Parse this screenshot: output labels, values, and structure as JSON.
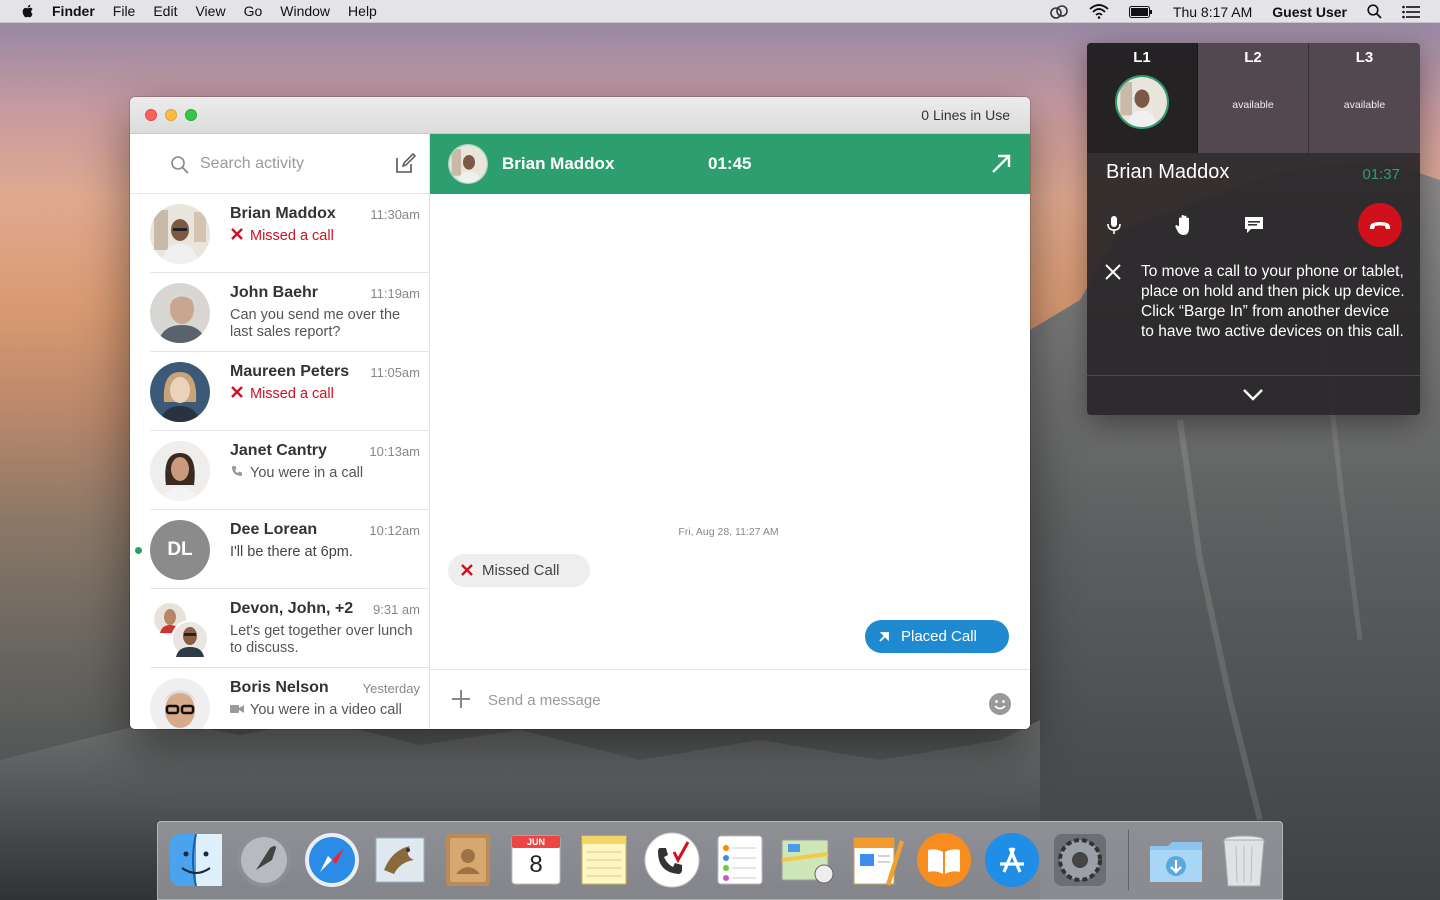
{
  "menubar": {
    "app_name": "Finder",
    "menus": [
      "File",
      "Edit",
      "View",
      "Go",
      "Window",
      "Help"
    ],
    "clock": "Thu 8:17 AM",
    "user": "Guest User"
  },
  "window": {
    "lines_in_use": "0 Lines in Use"
  },
  "sidebar": {
    "search_placeholder": "Search activity",
    "conversations": [
      {
        "name": "Brian Maddox",
        "time": "11:30am",
        "preview": "Missed a call",
        "kind": "missed"
      },
      {
        "name": "John Baehr",
        "time": "11:19am",
        "preview": "Can you send me over the last sales report?",
        "kind": "text"
      },
      {
        "name": "Maureen Peters",
        "time": "11:05am",
        "preview": "Missed a call",
        "kind": "missed"
      },
      {
        "name": "Janet Cantry",
        "time": "10:13am",
        "preview": "You were in a call",
        "kind": "call"
      },
      {
        "name": "Dee Lorean",
        "time": "10:12am",
        "preview": "I'll be there at 6pm.",
        "kind": "text",
        "initials": "DL"
      },
      {
        "name": "Devon, John, +2",
        "time": "9:31 am",
        "preview": "Let's get together over lunch to discuss.",
        "kind": "text"
      },
      {
        "name": "Boris Nelson",
        "time": "Yesterday",
        "preview": "You were in a video call",
        "kind": "video"
      }
    ]
  },
  "chat": {
    "header_name": "Brian Maddox",
    "header_time": "01:45",
    "date_stamp": "Fri, Aug 28, 11:27 AM",
    "missed_label": "Missed Call",
    "placed_label": "Placed Call",
    "message_placeholder": "Send a message"
  },
  "call_panel": {
    "lines": [
      {
        "label": "L1",
        "status": ""
      },
      {
        "label": "L2",
        "status": "available"
      },
      {
        "label": "L3",
        "status": "available"
      }
    ],
    "caller_name": "Brian Maddox",
    "call_time": "01:37",
    "tip": "To move a call to your phone or tablet, place on hold and then pick up device. Click “Barge In” from another device to have two active devices on this call."
  },
  "dock": {
    "items": [
      "finder-icon",
      "launchpad-icon",
      "safari-icon",
      "mail-icon",
      "contacts-icon",
      "calendar-icon",
      "notes-icon",
      "phone-app-icon",
      "reminders-icon",
      "maps-icon",
      "pages-icon",
      "ibooks-icon",
      "app-store-icon",
      "system-preferences-icon",
      "downloads-folder-icon",
      "trash-icon"
    ],
    "calendar_month": "JUN",
    "calendar_day": "8"
  },
  "colors": {
    "accent_green": "#2d9e6d",
    "missed_red": "#cf1020",
    "placed_blue": "#1f8ad0",
    "hangup_red": "#d0101b"
  }
}
